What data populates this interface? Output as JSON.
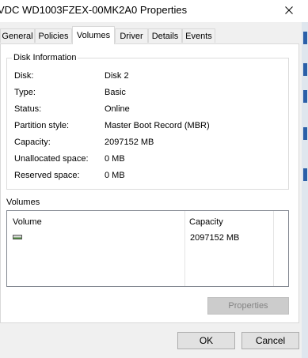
{
  "window": {
    "title": "VDC WD1003FZEX-00MK2A0 Properties",
    "close_icon": "close-icon"
  },
  "tabs": [
    {
      "label": "General",
      "active": false
    },
    {
      "label": "Policies",
      "active": false
    },
    {
      "label": "Volumes",
      "active": true
    },
    {
      "label": "Driver",
      "active": false
    },
    {
      "label": "Details",
      "active": false
    },
    {
      "label": "Events",
      "active": false
    }
  ],
  "disk_info": {
    "legend": "Disk Information",
    "rows": [
      {
        "label": "Disk:",
        "value": "Disk 2"
      },
      {
        "label": "Type:",
        "value": "Basic"
      },
      {
        "label": "Status:",
        "value": "Online"
      },
      {
        "label": "Partition style:",
        "value": "Master Boot Record (MBR)"
      },
      {
        "label": "Capacity:",
        "value": "2097152 MB"
      },
      {
        "label": "Unallocated space:",
        "value": "0 MB"
      },
      {
        "label": "Reserved space:",
        "value": "0 MB"
      }
    ]
  },
  "volumes": {
    "caption": "Volumes",
    "columns": [
      "Volume",
      "Capacity"
    ],
    "rows": [
      {
        "icon": "drive-icon",
        "volume": "",
        "capacity": "2097152 MB"
      }
    ]
  },
  "buttons": {
    "properties": "Properties",
    "ok": "OK",
    "cancel": "Cancel"
  }
}
